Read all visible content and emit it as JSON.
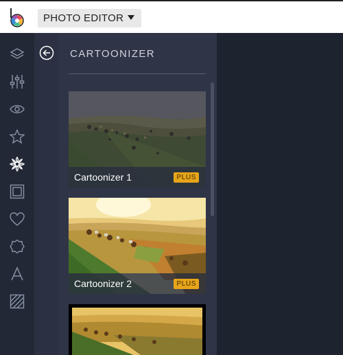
{
  "app": {
    "menu_label": "PHOTO EDITOR"
  },
  "rail": {
    "icons": [
      "layers-icon",
      "sliders-icon",
      "eye-icon",
      "star-icon",
      "effects-flower-icon",
      "frame-icon",
      "heart-icon",
      "shape-icon",
      "text-icon",
      "texture-icon"
    ]
  },
  "panel": {
    "title": "CARTOONIZER",
    "items": [
      {
        "name": "Cartoonizer 1",
        "badge": "PLUS"
      },
      {
        "name": "Cartoonizer 2",
        "badge": "PLUS"
      }
    ]
  },
  "colors": {
    "accent_badge": "#e8a51a",
    "rail_bg": "#222836",
    "panel_bg": "#2f3547",
    "canvas_bg": "#1e2330"
  }
}
